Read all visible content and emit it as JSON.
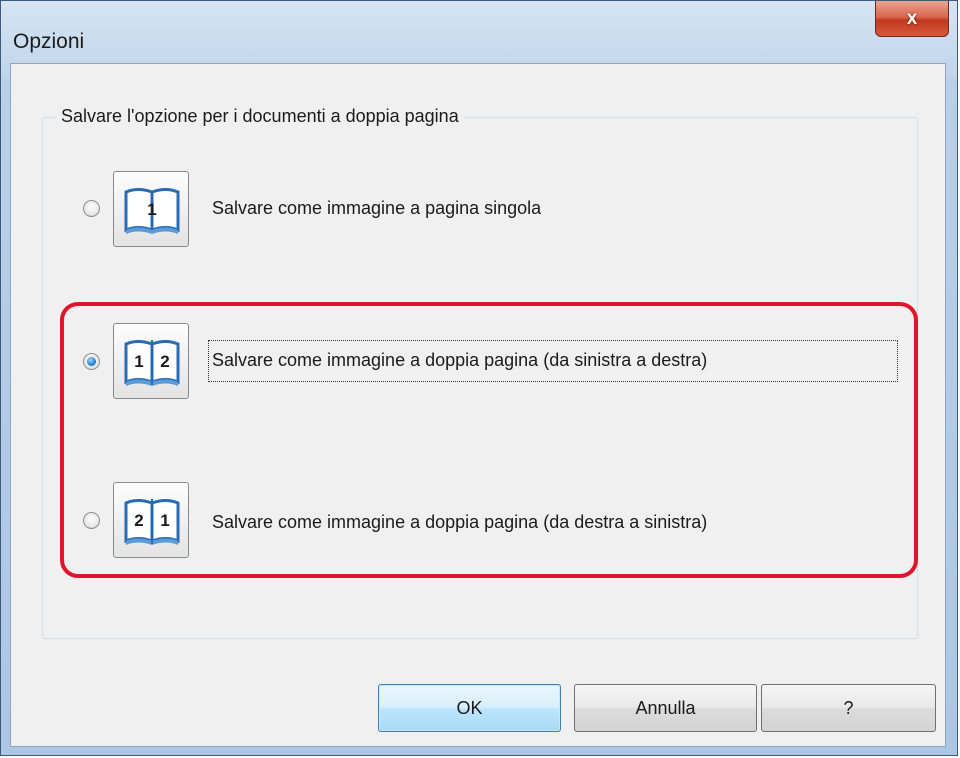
{
  "window": {
    "title": "Opzioni",
    "close_label": "x"
  },
  "group": {
    "title": "Salvare l'opzione per i documenti a doppia pagina"
  },
  "options": [
    {
      "label": "Salvare come immagine a pagina singola",
      "icon": "book-single-page-icon",
      "icon_text": "1",
      "selected": false
    },
    {
      "label": "Salvare come immagine a doppia pagina (da sinistra a destra)",
      "icon": "book-left-to-right-icon",
      "icon_text": "1 2",
      "selected": true
    },
    {
      "label": "Salvare come immagine a doppia pagina (da destra a sinistra)",
      "icon": "book-right-to-left-icon",
      "icon_text": "2 1",
      "selected": false
    }
  ],
  "buttons": {
    "ok": "OK",
    "cancel": "Annulla",
    "help": "?"
  },
  "colors": {
    "highlight": "#e0142d",
    "radio_selected": "#2d86d3",
    "close_button": "#c0391f"
  }
}
